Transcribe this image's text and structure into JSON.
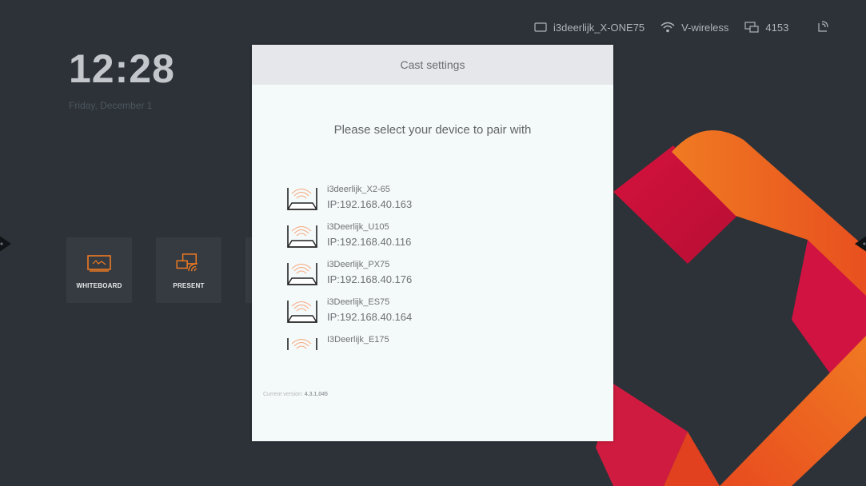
{
  "status_bar": {
    "display_name": "i3deerlijk_X-ONE75",
    "wifi_name": "V-wireless",
    "cast_code": "4153"
  },
  "clock": {
    "time": "12:28",
    "date": "Friday, December 1"
  },
  "tiles": [
    {
      "label": "WHITEBOARD",
      "icon": "whiteboard-icon"
    },
    {
      "label": "PRESENT",
      "icon": "present-cast-icon"
    }
  ],
  "dialog": {
    "title": "Cast settings",
    "subtitle": "Please select your device to pair with",
    "devices": [
      {
        "name": "i3deerlijk_X2-65",
        "ip": "IP:192.168.40.163"
      },
      {
        "name": "i3Deerlijk_U105",
        "ip": "IP:192.168.40.116"
      },
      {
        "name": "i3Deerlijk_PX75",
        "ip": "IP:192.168.40.176"
      },
      {
        "name": "i3Deerlijk_ES75",
        "ip": "IP:192.168.40.164"
      },
      {
        "name": "I3Deerlijk_E175",
        "ip": ""
      }
    ],
    "version_label": "Current version:",
    "version_number": "4.3.1.045"
  },
  "colors": {
    "background": "#2c3238",
    "accent_orange": "#f07a22",
    "accent_red": "#d8133f",
    "dialog_bg": "#f4f9f9",
    "dialog_header_bg": "#e6e7ea"
  }
}
